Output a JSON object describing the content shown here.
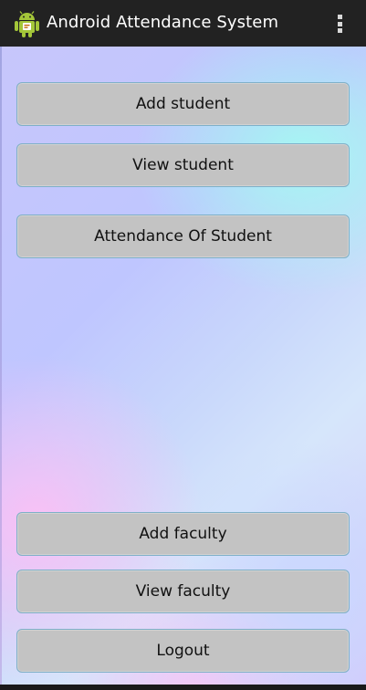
{
  "app": {
    "title": "Android Attendance System",
    "icon": "android-icon",
    "menu_icon": "overflow-menu-icon"
  },
  "buttons": {
    "add_student": "Add student",
    "view_student": "View student",
    "attendance_of_student": "Attendance Of Student",
    "add_faculty": "Add faculty",
    "view_faculty": "View faculty",
    "logout": "Logout"
  },
  "colors": {
    "actionbar": "#222222",
    "button_fill": "#c3c3c3",
    "button_border": "#7fb0c8",
    "android_green": "#a4c639"
  }
}
